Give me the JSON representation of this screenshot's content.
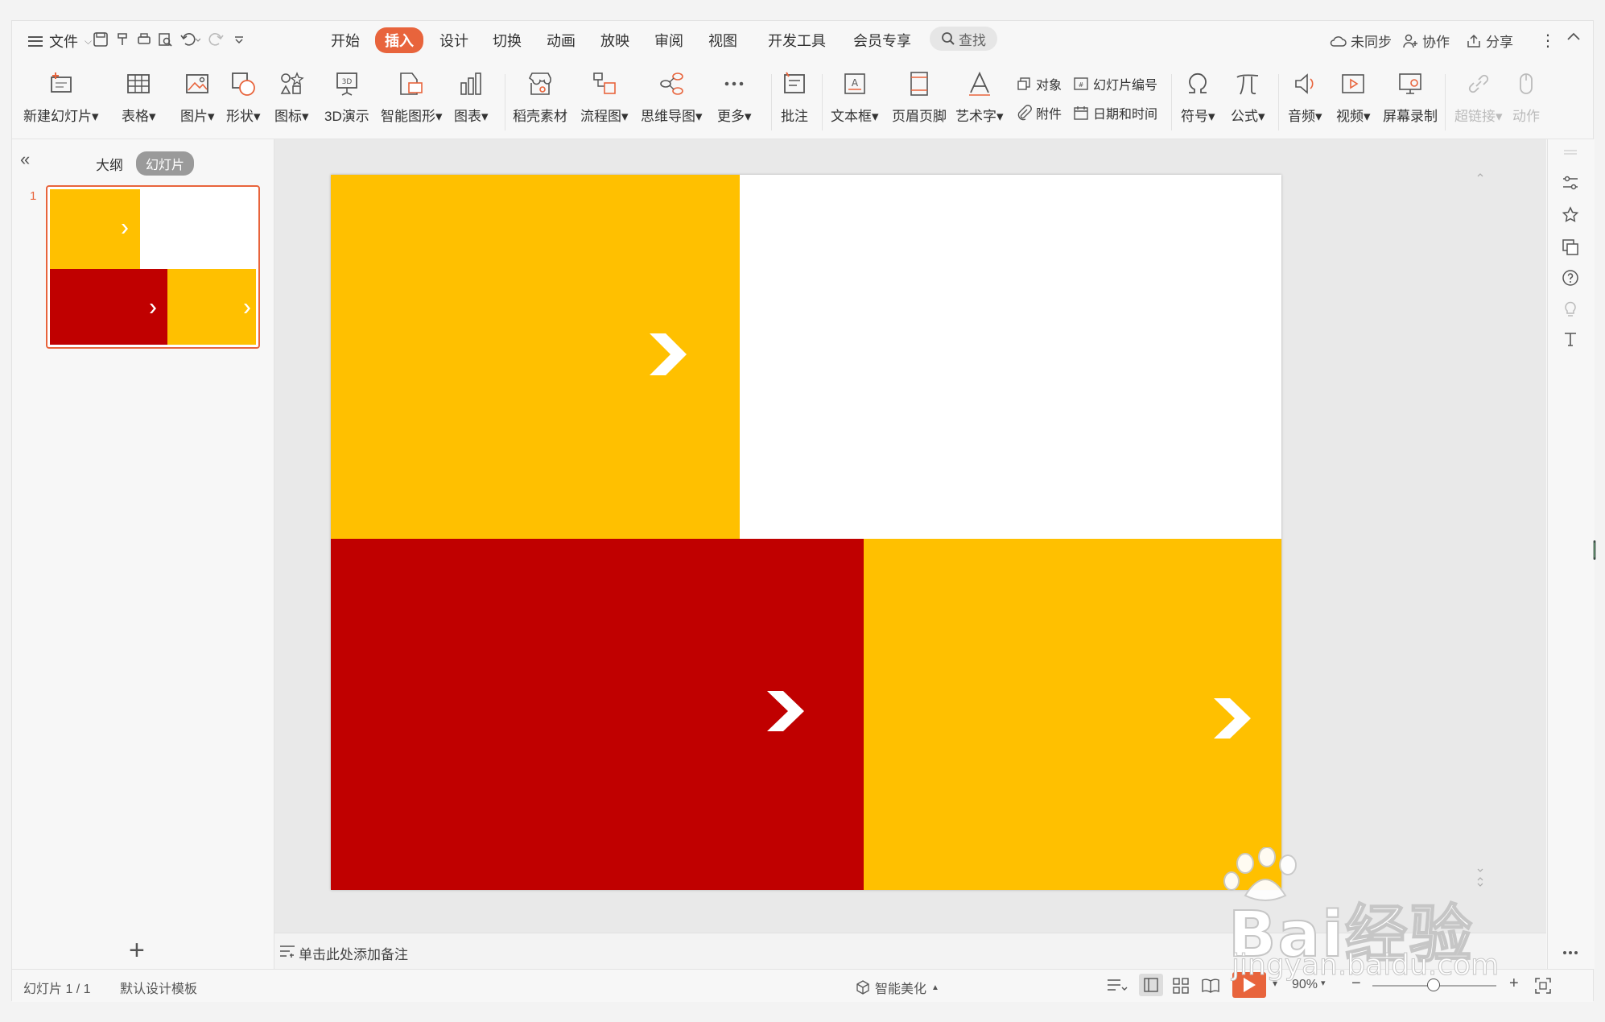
{
  "menubar": {
    "file": "文件",
    "tabs": [
      "开始",
      "插入",
      "设计",
      "切换",
      "动画",
      "放映",
      "审阅",
      "视图",
      "开发工具",
      "会员专享"
    ],
    "active_tab": "插入",
    "search": "查找",
    "right": {
      "sync": "未同步",
      "collab": "协作",
      "share": "分享"
    }
  },
  "ribbon": {
    "new_slide": "新建幻灯片",
    "table": "表格",
    "picture": "图片",
    "shape": "形状",
    "icon": "图标",
    "3d": "3D演示",
    "smartart": "智能图形",
    "chart": "图表",
    "material": "稻壳素材",
    "flowchart": "流程图",
    "mindmap": "思维导图",
    "more": "更多",
    "comment": "批注",
    "textbox": "文本框",
    "header_footer": "页眉页脚",
    "wordart": "艺术字",
    "object": "对象",
    "slide_number": "幻灯片编号",
    "attachment": "附件",
    "datetime": "日期和时间",
    "symbol": "符号",
    "formula": "公式",
    "audio": "音频",
    "video": "视频",
    "screen_record": "屏幕录制",
    "hyperlink": "超链接",
    "action": "动作"
  },
  "leftpanel": {
    "outline_tab": "大纲",
    "slides_tab": "幻灯片",
    "slide_number": "1"
  },
  "notes": {
    "placeholder": "单击此处添加备注"
  },
  "status": {
    "slide_info": "幻灯片 1 / 1",
    "template": "默认设计模板",
    "beautify": "智能美化",
    "zoom": "90%"
  },
  "colors": {
    "yellow": "#FFC000",
    "red": "#C00000",
    "accent": "#e8643c"
  },
  "watermark": {
    "brand": "Bai经验",
    "url": "jingyan.baidu.com"
  }
}
